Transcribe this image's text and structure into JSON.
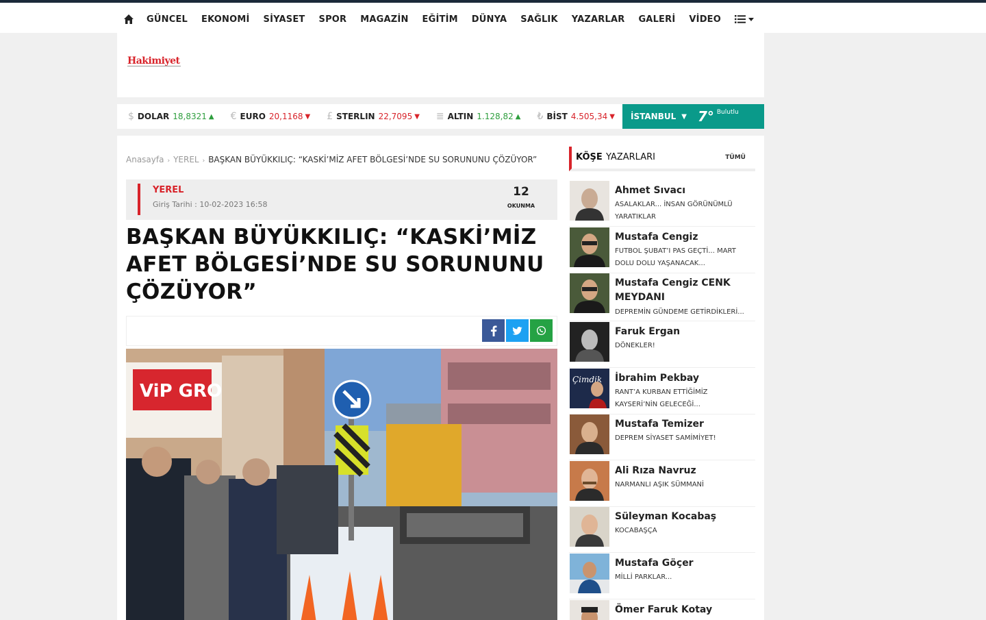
{
  "nav": {
    "items": [
      "GÜNCEL",
      "EKONOMİ",
      "SİYASET",
      "SPOR",
      "MAGAZİN",
      "EĞİTİM",
      "DÜNYA",
      "SAĞLIK",
      "YAZARLAR",
      "GALERİ",
      "VİDEO"
    ]
  },
  "logo": {
    "text": "Hakimiyet"
  },
  "market": {
    "dolar": {
      "name": "DOLAR",
      "value": "18,8321",
      "dir": "up"
    },
    "euro": {
      "name": "EURO",
      "value": "20,1168",
      "dir": "down"
    },
    "sterlin": {
      "name": "STERLIN",
      "value": "22,7095",
      "dir": "down"
    },
    "altin": {
      "name": "ALTIN",
      "value": "1.128,82",
      "dir": "up"
    },
    "bist": {
      "name": "BİST",
      "value": "4.505,34",
      "dir": "down"
    }
  },
  "weather": {
    "city": "İSTANBUL",
    "temp": "7°",
    "condition": "Bulutlu"
  },
  "breadcrumb": {
    "home": "Anasayfa",
    "section": "YEREL",
    "current": "BAŞKAN BÜYÜKKILIÇ: “KASKİ’MİZ AFET BÖLGESİ’NDE SU SORUNUNU ÇÖZÜYOR”"
  },
  "article": {
    "category": "YEREL",
    "date": "Giriş Tarihi : 10-02-2023 16:58",
    "read_count": "12",
    "read_label": "OKUNMA",
    "title": "BAŞKAN BÜYÜKKILIÇ: “KASKİ’MİZ AFET BÖLGESİ’NDE SU SORUNUNU ÇÖZÜYOR”"
  },
  "sidebar": {
    "title_bold": "KÖŞE",
    "title_rest": "YAZARLARI",
    "all_label": "TÜMÜ",
    "authors": [
      {
        "name": "Ahmet Sıvacı",
        "article": "ASALAKLAR... İNSAN GÖRÜNÜMLÜ YARATIKLAR"
      },
      {
        "name": "Mustafa Cengiz",
        "article": "FUTBOL ŞUBAT’I PAS GEÇTİ... MART DOLU DOLU YAŞANACAK..."
      },
      {
        "name": "Mustafa Cengiz CENK MEYDANI",
        "article": "DEPREMİN GÜNDEME GETİRDİKLERİ..."
      },
      {
        "name": "Faruk Ergan",
        "article": "DÖNEKLER!"
      },
      {
        "name": "İbrahim Pekbay",
        "article": "RANT’A KURBAN ETTİĞİMİZ KAYSERİ’NİN GELECEĞİ..."
      },
      {
        "name": "Mustafa Temizer",
        "article": "DEPREM SİYASET SAMİMİYET!"
      },
      {
        "name": "Ali Rıza Navruz",
        "article": "NARMANLI AŞIK SÜMMANİ"
      },
      {
        "name": "Süleyman Kocabaş",
        "article": "KOCABAŞÇA"
      },
      {
        "name": "Mustafa Göçer",
        "article": "MİLLİ PARKLAR..."
      },
      {
        "name": "Ömer Faruk Kotay",
        "article": ""
      }
    ]
  },
  "colors": {
    "accent": "#d8232a",
    "weather_bg": "#0a9a8a",
    "up": "#2e9e3e",
    "down": "#d8232a"
  }
}
